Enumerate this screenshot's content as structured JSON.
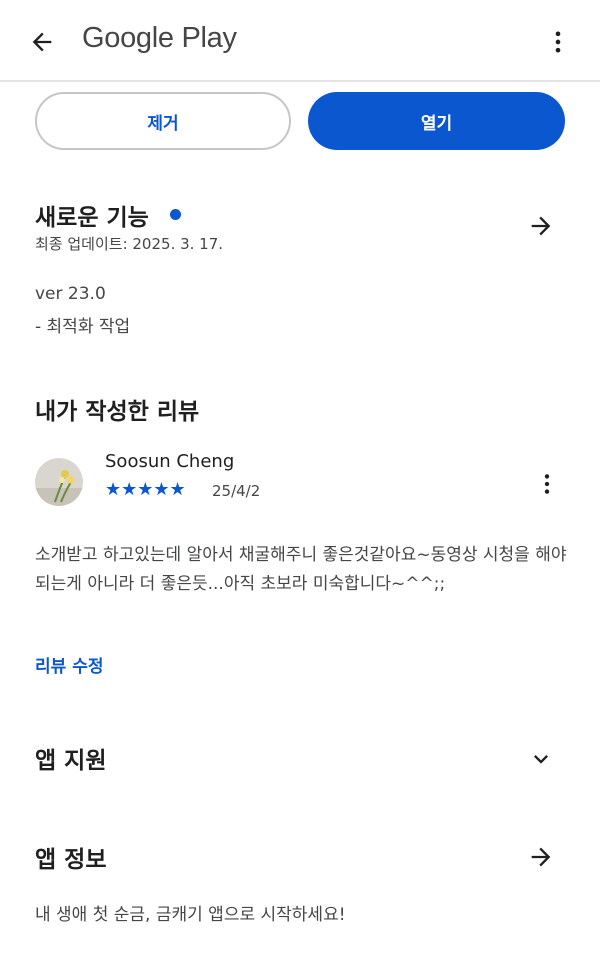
{
  "header": {
    "title": "Google Play",
    "back_icon": "arrow-back-icon",
    "more_icon": "more-vert-icon"
  },
  "actions": {
    "remove_label": "제거",
    "open_label": "열기"
  },
  "whats_new": {
    "title": "새로운 기능",
    "updated": "최종 업데이트: 2025. 3. 17.",
    "version": "ver 23.0",
    "note": "- 최적화 작업",
    "arrow_icon": "arrow-forward-icon",
    "dot_color": "#0b57d0"
  },
  "my_review": {
    "title": "내가 작성한 리뷰",
    "reviewer": "Soosun Cheng",
    "rating": 5,
    "stars": "★★★★★",
    "date": "25/4/2",
    "text": "소개받고 하고있는데 알아서 채굴해주니 좋은것같아요~동영상 시청을 해야 되는게 아니라 더 좋은듯...아직 초보라 미숙합니다~^^;;",
    "edit_label": "리뷰 수정"
  },
  "support": {
    "title": "앱 지원",
    "chevron_icon": "chevron-down-icon"
  },
  "about": {
    "title": "앱 정보",
    "description": "내 생애 첫 순금, 금캐기 앱으로 시작하세요!",
    "arrow_icon": "arrow-forward-icon"
  },
  "colors": {
    "accent": "#0b57d0",
    "text_primary": "#1f1f1f",
    "text_secondary": "#444746"
  }
}
